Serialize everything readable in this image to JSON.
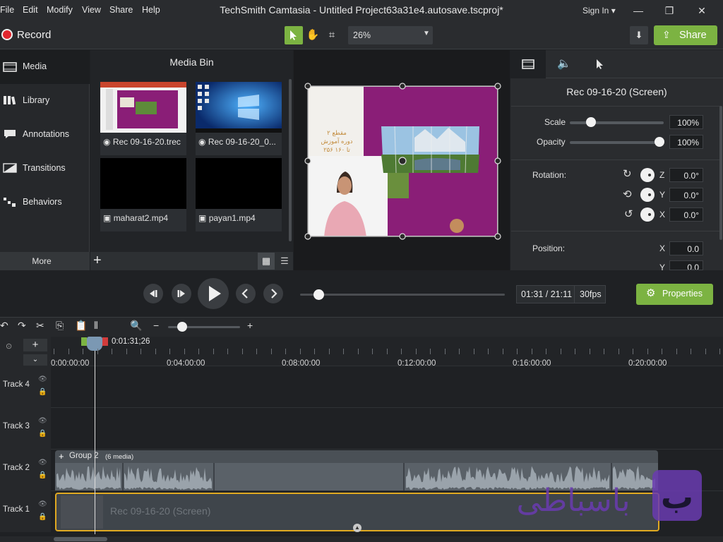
{
  "menu": [
    "File",
    "Edit",
    "Modify",
    "View",
    "Share",
    "Help"
  ],
  "app_title": "TechSmith Camtasia - Untitled Project63a31e4.autosave.tscproj*",
  "signin": "Sign In",
  "toolbar": {
    "record_label": "Record",
    "zoom": "26%",
    "share_label": "Share"
  },
  "nav": [
    "Media",
    "Library",
    "Annotations",
    "Transitions",
    "Behaviors"
  ],
  "more_label": "More",
  "media_bin": {
    "title": "Media Bin",
    "items": [
      "Rec 09-16-20.trec",
      "Rec 09-16-20_0...",
      "maharat2.mp4",
      "payan1.mp4"
    ]
  },
  "properties": {
    "title": "Rec 09-16-20 (Screen)",
    "scale_label": "Scale",
    "scale_value": "100%",
    "opacity_label": "Opacity",
    "opacity_value": "100%",
    "rotation_label": "Rotation:",
    "rot_z": "0.0°",
    "rot_y": "0.0°",
    "rot_x": "0.0°",
    "position_label": "Position:",
    "pos_x": "0.0",
    "pos_y": "0.0",
    "axis_z": "Z",
    "axis_y": "Y",
    "axis_x": "X",
    "axis_x2": "X",
    "axis_y2": "Y"
  },
  "transport": {
    "time": "01:31 / 21:11",
    "fps": "30fps",
    "properties_label": "Properties"
  },
  "timeline": {
    "playhead_time": "0:01:31;26",
    "ruler": [
      "0:00:00;00",
      "0:04:00;00",
      "0:08:00;00",
      "0:12:00;00",
      "0:16:00;00",
      "0:20:00;00"
    ],
    "tracks": [
      "Track 4",
      "Track 3",
      "Track 2",
      "Track 1"
    ],
    "group_label": "Group 2",
    "group_count": "(6 media)",
    "track1_clip": "Rec 09-16-20 (Screen)"
  },
  "canvas_text": [
    "مقطع ۲",
    "دوره آموزش",
    "۲۵۶ تا ۱۶۰"
  ],
  "watermark": "باسباطی",
  "colors": {
    "accent_green": "#7cb342",
    "record_red": "#e0262e",
    "selection_gold": "#e0a921",
    "canvas_purple": "#8a1e77"
  }
}
